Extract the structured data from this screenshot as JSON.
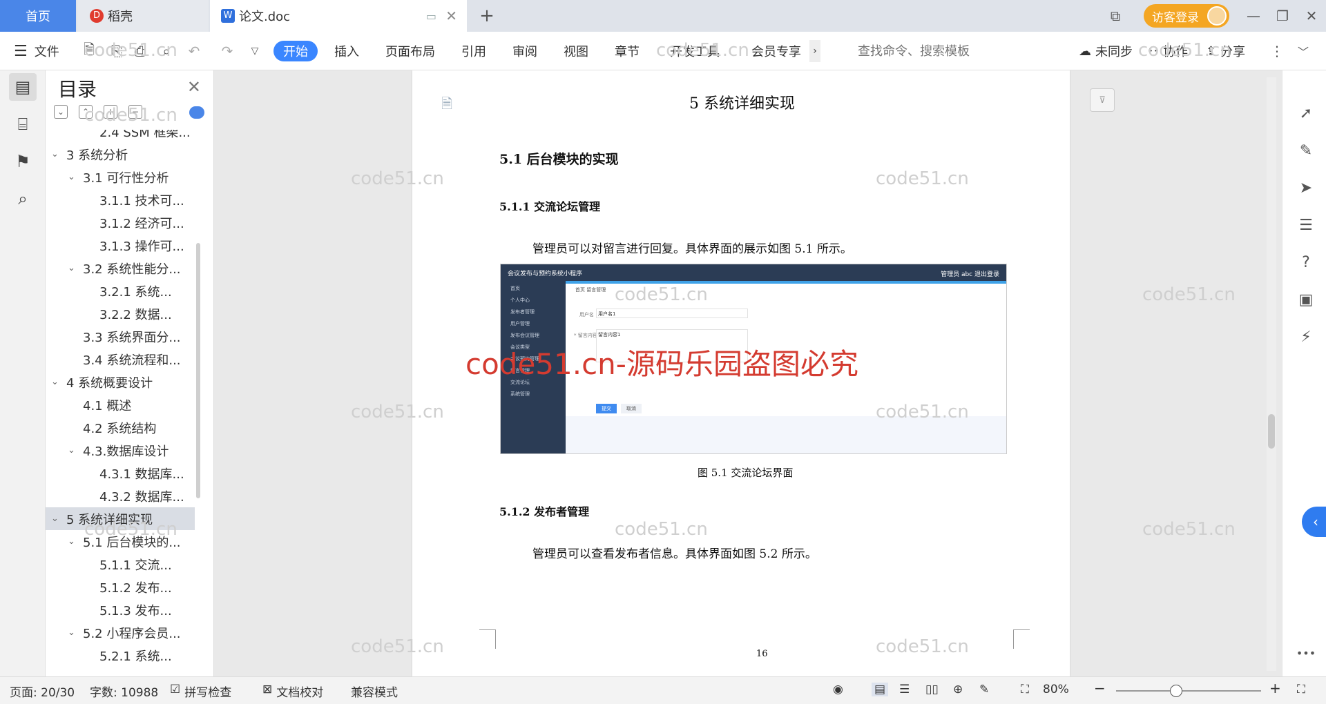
{
  "tabs": {
    "home": "首页",
    "daoke": "稻壳",
    "doc": "论文.doc",
    "visitor": "访客登录"
  },
  "ribbon": {
    "file": "文件",
    "tabs": [
      "开始",
      "插入",
      "页面布局",
      "引用",
      "审阅",
      "视图",
      "章节",
      "开发工具",
      "会员专享"
    ],
    "search_placeholder": "查找命令、搜索模板",
    "sync": "未同步",
    "collab": "协作",
    "share": "分享"
  },
  "toc": {
    "title": "目录",
    "items": [
      {
        "label": "2.4 SSM 框架...",
        "level": 2,
        "caret": ""
      },
      {
        "label": "3 系统分析",
        "level": 0,
        "caret": "v"
      },
      {
        "label": "3.1 可行性分析",
        "level": 1,
        "caret": "v"
      },
      {
        "label": "3.1.1 技术可...",
        "level": 2,
        "caret": ""
      },
      {
        "label": "3.1.2 经济可...",
        "level": 2,
        "caret": ""
      },
      {
        "label": "3.1.3 操作可...",
        "level": 2,
        "caret": ""
      },
      {
        "label": "3.2 系统性能分...",
        "level": 1,
        "caret": "v"
      },
      {
        "label": "3.2.1 系统...",
        "level": 2,
        "caret": ""
      },
      {
        "label": "3.2.2 数据...",
        "level": 2,
        "caret": ""
      },
      {
        "label": "3.3 系统界面分...",
        "level": 1,
        "caret": ""
      },
      {
        "label": "3.4 系统流程和...",
        "level": 1,
        "caret": ""
      },
      {
        "label": "4 系统概要设计",
        "level": 0,
        "caret": "v"
      },
      {
        "label": "4.1 概述",
        "level": 1,
        "caret": ""
      },
      {
        "label": "4.2 系统结构",
        "level": 1,
        "caret": ""
      },
      {
        "label": "4.3.数据库设计",
        "level": 1,
        "caret": "v"
      },
      {
        "label": "4.3.1 数据库...",
        "level": 2,
        "caret": ""
      },
      {
        "label": "4.3.2 数据库...",
        "level": 2,
        "caret": ""
      },
      {
        "label": "5 系统详细实现",
        "level": 0,
        "caret": "v",
        "selected": true
      },
      {
        "label": "5.1 后台模块的...",
        "level": 1,
        "caret": "v"
      },
      {
        "label": "5.1.1 交流...",
        "level": 2,
        "caret": ""
      },
      {
        "label": "5.1.2 发布...",
        "level": 2,
        "caret": ""
      },
      {
        "label": "5.1.3 发布...",
        "level": 2,
        "caret": ""
      },
      {
        "label": "5.2 小程序会员...",
        "level": 1,
        "caret": "v"
      },
      {
        "label": "5.2.1 系统...",
        "level": 2,
        "caret": ""
      }
    ]
  },
  "doc": {
    "chapter_title": "5 系统详细实现",
    "h2": "5.1  后台模块的实现",
    "h3a": "5.1.1  交流论坛管理",
    "p1": "管理员可以对留言进行回复。具体界面的展示如图 5.1 所示。",
    "caption": "图 5.1  交流论坛界面",
    "h3b": "5.1.2  发布者管理",
    "p2": "管理员可以查看发布者信息。具体界面如图 5.2 所示。",
    "page_number": "16",
    "watermark": "code51.cn",
    "big_watermark": "code51.cn-源码乐园盗图必究",
    "fig": {
      "app_title": "会议发布与预约系统小程序",
      "topright": "管理员 abc   退出登录",
      "menu": [
        "首页",
        "个人中心",
        "发布者管理",
        "用户管理",
        "发布会议管理",
        "会议类型",
        "会议预约管理",
        "留言管理",
        "交流论坛",
        "系统管理"
      ],
      "crumb": "首页  留言管理",
      "field1_label": "用户名",
      "field1_value": "用户名1",
      "field2_label": "* 留言内容",
      "field2_value": "留言内容1",
      "btn_submit": "提交",
      "btn_cancel": "取消"
    }
  },
  "status": {
    "page": "页面: 20/30",
    "words": "字数: 10988",
    "spell": "拼写检查",
    "proof": "文档校对",
    "compat": "兼容模式",
    "zoom": "80%"
  }
}
